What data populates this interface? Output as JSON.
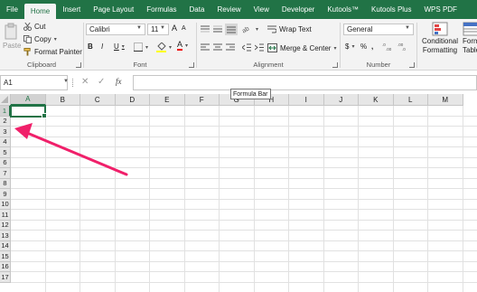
{
  "tabs": [
    "File",
    "Home",
    "Insert",
    "Page Layout",
    "Formulas",
    "Data",
    "Review",
    "View",
    "Developer",
    "Kutools™",
    "Kutools Plus",
    "WPS PDF"
  ],
  "active_tab": "Home",
  "clipboard": {
    "paste": "Paste",
    "cut": "Cut",
    "copy": "Copy",
    "format_painter": "Format Painter",
    "label": "Clipboard"
  },
  "font": {
    "name": "Calibri",
    "size": "11",
    "grow": "A",
    "shrink": "A",
    "bold": "B",
    "italic": "I",
    "underline": "U",
    "label": "Font"
  },
  "alignment": {
    "wrap_text": "Wrap Text",
    "merge_center": "Merge & Center",
    "label": "Alignment"
  },
  "number": {
    "format": "General",
    "currency": "$",
    "percent": "%",
    "comma": ",",
    "label": "Number"
  },
  "styles": {
    "conditional": "Conditional",
    "formatting": "Formatting",
    "format_as": "Forma",
    "table": "Table"
  },
  "formula_bar": {
    "name_box": "A1",
    "fx": "fx",
    "tooltip": "Formula Bar"
  },
  "columns": [
    "A",
    "B",
    "C",
    "D",
    "E",
    "F",
    "G",
    "H",
    "I",
    "J",
    "K",
    "L",
    "M"
  ],
  "rows": [
    "1",
    "2",
    "3",
    "4",
    "5",
    "6",
    "7",
    "8",
    "9",
    "10",
    "11",
    "12",
    "13",
    "14",
    "15",
    "16",
    "17"
  ],
  "colors": {
    "excel_green": "#217346",
    "arrow": "#f0206a"
  }
}
